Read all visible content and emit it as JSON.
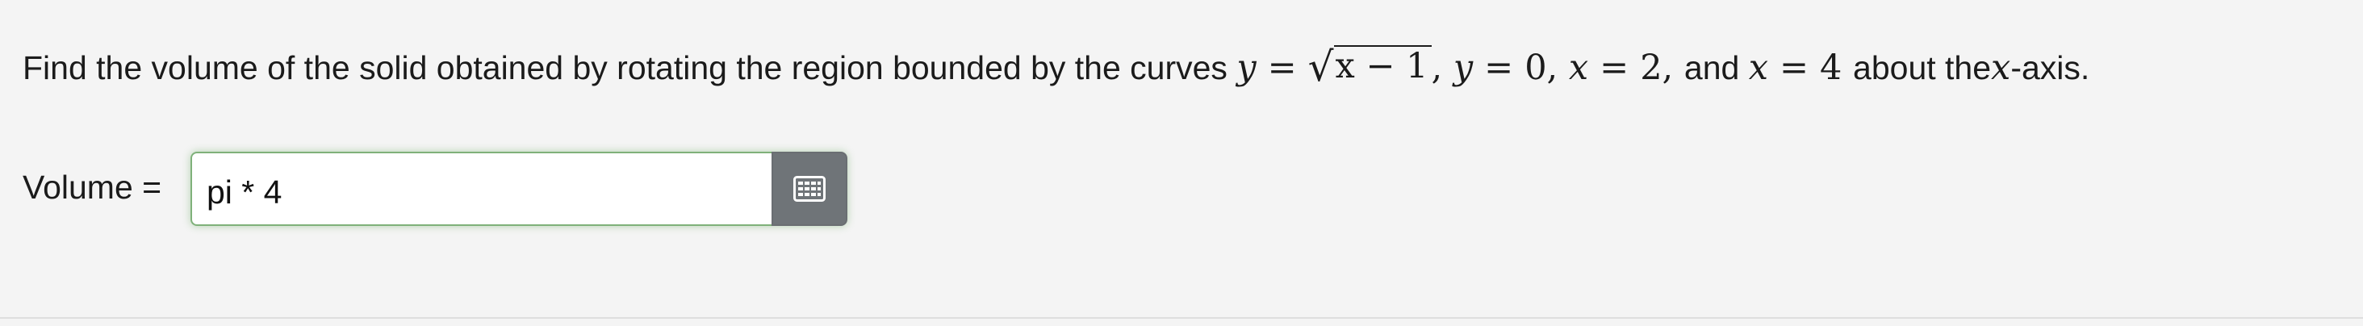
{
  "question": {
    "text_before": "Find the volume of the solid obtained by rotating the region bounded by the curves",
    "curve1_lhs": "y",
    "eq": "=",
    "sqrt_radicand": "x − 1",
    "comma1": ",",
    "curve2_lhs": "y",
    "curve2_rhs": "0",
    "comma2": ",",
    "curve3_lhs": "x",
    "curve3_rhs": "2",
    "comma3": ",",
    "and_text": "and",
    "curve4_lhs": "x",
    "curve4_rhs": "4",
    "about_text": "about the",
    "axis_var": "x",
    "axis_suffix": "-axis."
  },
  "answer": {
    "label": "Volume =",
    "value": "pi * 4",
    "keyboard_icon": "keyboard-icon"
  },
  "colors": {
    "background": "#f4f4f4",
    "input_border": "#7fb17a",
    "button_bg": "#6f7478"
  }
}
